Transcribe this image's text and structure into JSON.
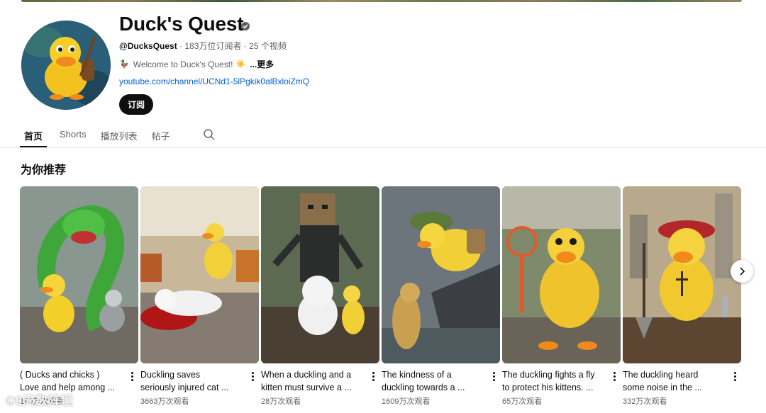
{
  "channel": {
    "name": "Duck's Quest",
    "handle": "@DucksQuest",
    "subscribers": "183万位订阅者",
    "video_count": "25 个视频",
    "meta_sep": "·",
    "description": "Welcome to Duck's Quest!",
    "more_label": "...更多",
    "link": "youtube.com/channel/UCNd1-5lPgkik0alBxloiZmQ",
    "subscribe_label": "订阅"
  },
  "tabs": [
    {
      "label": "首页",
      "active": true
    },
    {
      "label": "Shorts",
      "active": false
    },
    {
      "label": "播放列表",
      "active": false
    },
    {
      "label": "帖子",
      "active": false
    }
  ],
  "section": {
    "title": "为你推荐"
  },
  "videos": [
    {
      "title_line1": "( Ducks and chicks )",
      "title_line2": "Love and help among ...",
      "views": "190万次观看",
      "icon": "snake-duckling-thumbnail"
    },
    {
      "title_line1": "Duckling saves",
      "title_line2": "seriously injured cat ...",
      "views": "3663万次观看",
      "icon": "injured-cat-thumbnail"
    },
    {
      "title_line1": "When a duckling and a",
      "title_line2": "kitten must survive a ...",
      "views": "28万次观看",
      "icon": "boxhead-monster-thumbnail"
    },
    {
      "title_line1": "The kindness of a",
      "title_line2": "duckling towards a ...",
      "views": "1609万次观看",
      "icon": "cliff-rescue-thumbnail"
    },
    {
      "title_line1": "The duckling fights a fly",
      "title_line2": "to protect his kittens. ...",
      "views": "65万次观看",
      "icon": "fly-swatter-thumbnail"
    },
    {
      "title_line1": "The duckling heard",
      "title_line2": "some noise in the ...",
      "views": "332万次观看",
      "icon": "graveyard-duckling-thumbnail"
    }
  ],
  "watermark": "©9天数阵境",
  "colors": {
    "link": "#065fd4",
    "accent_dark": "#0f0f0f",
    "secondary_text": "#606060"
  }
}
